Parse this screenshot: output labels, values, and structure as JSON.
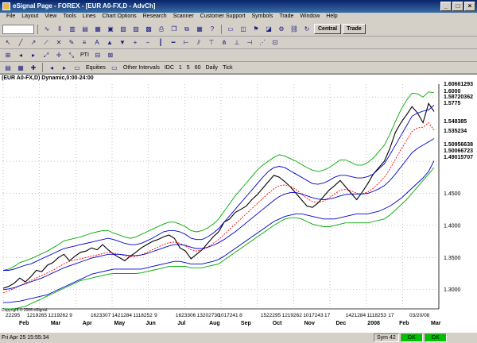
{
  "window": {
    "title": "eSignal Page - FOREX - [EUR A0-FX,D - AdvCh]"
  },
  "menu": [
    "File",
    "Layout",
    "View",
    "Tools",
    "Lines",
    "Chart Options",
    "Research",
    "Scanner",
    "Customer Support",
    "Symbols",
    "Trade",
    "Window",
    "Help"
  ],
  "toolbar": {
    "central_label": "Central",
    "trade_label": "Trade",
    "pti_label": "PTI"
  },
  "interval_bar": {
    "equities_label": "Equities",
    "other_intervals_label": "Other Intervals",
    "intervals": [
      "IDC",
      "1",
      "5",
      "60",
      "Daily",
      "Tick"
    ]
  },
  "chart": {
    "title": "(EUR A0-FX,D) Dynamic,0:00-24:00",
    "copyright": "Copyright © 2006 eSignal."
  },
  "chart_data": {
    "type": "line",
    "price_axis_labels": [
      "1.4000",
      "1.4500",
      "1.3500",
      "1.3000"
    ],
    "value_tags": [
      {
        "value": "1.60661293",
        "bg": "#ffffff"
      },
      {
        "value": "1.6000",
        "bg": "#ffffff"
      },
      {
        "value": "1.58720362",
        "bg": "#ffffff"
      },
      {
        "value": "1.5775",
        "bg": "#ffffff"
      },
      {
        "value": "1.548385",
        "bg": "#ffffff"
      },
      {
        "value": "1.535234",
        "bg": "#ffffff"
      },
      {
        "value": "1.50956638",
        "bg": "#ffffff"
      },
      {
        "value": "1.50066723",
        "bg": "#ffffff"
      },
      {
        "value": "1.49015707",
        "bg": "#ffffff"
      }
    ],
    "date_number_row": [
      "22295",
      "1219265",
      "1219262",
      "9",
      "1623307",
      "1421284",
      "1118252",
      "9",
      "1623306",
      "13202730",
      "1017241",
      "8",
      "1522295",
      "1219262",
      "1017243",
      "17",
      "1421284",
      "1118253",
      "17",
      "03/20/08"
    ],
    "month_labels": [
      "Feb",
      "Mar",
      "Apr",
      "May",
      "Jun",
      "Jul",
      "Aug",
      "Sep",
      "Oct",
      "Nov",
      "Dec",
      "2008",
      "Feb",
      "Mar"
    ],
    "series": [
      {
        "color": "#000000",
        "values": [
          1.302,
          1.305,
          1.31,
          1.318,
          1.312,
          1.32,
          1.33,
          1.328,
          1.338,
          1.342,
          1.35,
          1.355,
          1.345,
          1.352,
          1.358,
          1.36,
          1.365,
          1.362,
          1.37,
          1.362,
          1.355,
          1.35,
          1.345,
          1.352,
          1.358,
          1.365,
          1.37,
          1.375,
          1.378,
          1.382,
          1.385,
          1.38,
          1.365,
          1.36,
          1.348,
          1.355,
          1.362,
          1.372,
          1.382,
          1.39,
          1.405,
          1.41,
          1.42,
          1.425,
          1.43,
          1.44,
          1.448,
          1.458,
          1.468,
          1.478,
          1.475,
          1.468,
          1.46,
          1.45,
          1.44,
          1.43,
          1.428,
          1.435,
          1.445,
          1.455,
          1.462,
          1.47,
          1.46,
          1.45,
          1.44,
          1.452,
          1.465,
          1.48,
          1.49,
          1.5,
          1.52,
          1.545,
          1.56,
          1.572,
          1.585,
          1.575,
          1.56,
          1.59,
          1.5775
        ]
      },
      {
        "color": "#ff0000",
        "values": [
          1.295,
          1.298,
          1.302,
          1.306,
          1.31,
          1.314,
          1.318,
          1.322,
          1.326,
          1.33,
          1.335,
          1.34,
          1.344,
          1.346,
          1.348,
          1.35,
          1.352,
          1.354,
          1.356,
          1.358,
          1.357,
          1.355,
          1.353,
          1.351,
          1.352,
          1.354,
          1.358,
          1.362,
          1.366,
          1.37,
          1.373,
          1.374,
          1.372,
          1.368,
          1.362,
          1.36,
          1.362,
          1.366,
          1.372,
          1.378,
          1.386,
          1.394,
          1.402,
          1.41,
          1.418,
          1.426,
          1.434,
          1.442,
          1.45,
          1.457,
          1.462,
          1.463,
          1.461,
          1.456,
          1.449,
          1.442,
          1.437,
          1.436,
          1.438,
          1.443,
          1.449,
          1.455,
          1.456,
          1.454,
          1.45,
          1.449,
          1.452,
          1.458,
          1.466,
          1.475,
          1.488,
          1.503,
          1.518,
          1.532,
          1.546,
          1.552,
          1.553,
          1.56,
          1.548385
        ]
      },
      {
        "color": "#0000cc",
        "values": [
          1.3,
          1.301,
          1.303,
          1.306,
          1.309,
          1.312,
          1.315,
          1.318,
          1.322,
          1.326,
          1.33,
          1.334,
          1.337,
          1.34,
          1.343,
          1.346,
          1.349,
          1.351,
          1.353,
          1.355,
          1.355,
          1.355,
          1.354,
          1.353,
          1.353,
          1.354,
          1.356,
          1.359,
          1.362,
          1.365,
          1.368,
          1.37,
          1.37,
          1.369,
          1.366,
          1.364,
          1.364,
          1.366,
          1.369,
          1.373,
          1.378,
          1.384,
          1.39,
          1.397,
          1.404,
          1.411,
          1.418,
          1.425,
          1.432,
          1.439,
          1.445,
          1.449,
          1.451,
          1.451,
          1.449,
          1.446,
          1.443,
          1.441,
          1.44,
          1.441,
          1.443,
          1.446,
          1.448,
          1.449,
          1.449,
          1.449,
          1.45,
          1.453,
          1.457,
          1.462,
          1.47,
          1.48,
          1.491,
          1.502,
          1.513,
          1.52,
          1.525,
          1.53,
          1.535234
        ]
      },
      {
        "color": "#00aa00",
        "values": [
          1.33,
          1.332,
          1.336,
          1.342,
          1.345,
          1.348,
          1.352,
          1.356,
          1.36,
          1.365,
          1.37,
          1.376,
          1.378,
          1.38,
          1.382,
          1.385,
          1.388,
          1.39,
          1.392,
          1.392,
          1.388,
          1.385,
          1.382,
          1.38,
          1.382,
          1.386,
          1.39,
          1.394,
          1.398,
          1.402,
          1.405,
          1.405,
          1.402,
          1.398,
          1.392,
          1.39,
          1.392,
          1.396,
          1.402,
          1.41,
          1.422,
          1.434,
          1.446,
          1.456,
          1.466,
          1.476,
          1.486,
          1.494,
          1.5,
          1.506,
          1.51,
          1.508,
          1.504,
          1.5,
          1.495,
          1.49,
          1.486,
          1.484,
          1.486,
          1.49,
          1.496,
          1.502,
          1.502,
          1.498,
          1.494,
          1.494,
          1.498,
          1.505,
          1.515,
          1.525,
          1.542,
          1.562,
          1.58,
          1.595,
          1.606,
          1.605,
          1.6,
          1.608,
          1.60661293
        ]
      },
      {
        "color": "#00aa00",
        "values": [
          1.27,
          1.27,
          1.27,
          1.272,
          1.274,
          1.278,
          1.282,
          1.286,
          1.29,
          1.294,
          1.298,
          1.302,
          1.306,
          1.31,
          1.314,
          1.316,
          1.318,
          1.32,
          1.322,
          1.324,
          1.325,
          1.325,
          1.325,
          1.325,
          1.325,
          1.326,
          1.328,
          1.33,
          1.332,
          1.334,
          1.336,
          1.336,
          1.336,
          1.336,
          1.334,
          1.334,
          1.334,
          1.336,
          1.338,
          1.34,
          1.346,
          1.352,
          1.358,
          1.364,
          1.37,
          1.376,
          1.382,
          1.388,
          1.394,
          1.4,
          1.405,
          1.41,
          1.412,
          1.412,
          1.41,
          1.406,
          1.402,
          1.4,
          1.398,
          1.398,
          1.4,
          1.402,
          1.404,
          1.404,
          1.404,
          1.404,
          1.404,
          1.406,
          1.408,
          1.41,
          1.416,
          1.424,
          1.432,
          1.44,
          1.45,
          1.46,
          1.47,
          1.48,
          1.49015707
        ]
      },
      {
        "color": "#0000cc",
        "values": [
          1.33,
          1.33,
          1.332,
          1.335,
          1.338,
          1.34,
          1.344,
          1.348,
          1.352,
          1.356,
          1.36,
          1.364,
          1.366,
          1.368,
          1.37,
          1.372,
          1.374,
          1.376,
          1.378,
          1.38,
          1.378,
          1.375,
          1.372,
          1.37,
          1.37,
          1.372,
          1.376,
          1.38,
          1.385,
          1.39,
          1.392,
          1.392,
          1.39,
          1.386,
          1.38,
          1.378,
          1.378,
          1.382,
          1.388,
          1.395,
          1.405,
          1.415,
          1.425,
          1.435,
          1.445,
          1.455,
          1.465,
          1.475,
          1.484,
          1.49,
          1.492,
          1.49,
          1.485,
          1.48,
          1.475,
          1.47,
          1.465,
          1.464,
          1.466,
          1.47,
          1.475,
          1.478,
          1.478,
          1.476,
          1.474,
          1.474,
          1.476,
          1.48,
          1.488,
          1.496,
          1.51,
          1.525,
          1.54,
          1.555,
          1.57,
          1.575,
          1.578,
          1.58,
          1.58720362
        ]
      },
      {
        "color": "#0000cc",
        "values": [
          1.28,
          1.28,
          1.281,
          1.282,
          1.284,
          1.286,
          1.288,
          1.29,
          1.292,
          1.296,
          1.3,
          1.304,
          1.308,
          1.312,
          1.316,
          1.32,
          1.324,
          1.326,
          1.328,
          1.33,
          1.332,
          1.332,
          1.332,
          1.332,
          1.332,
          1.332,
          1.334,
          1.336,
          1.338,
          1.34,
          1.342,
          1.344,
          1.344,
          1.342,
          1.34,
          1.34,
          1.34,
          1.342,
          1.344,
          1.347,
          1.352,
          1.358,
          1.364,
          1.37,
          1.376,
          1.382,
          1.388,
          1.394,
          1.4,
          1.406,
          1.41,
          1.414,
          1.416,
          1.418,
          1.418,
          1.416,
          1.414,
          1.412,
          1.41,
          1.41,
          1.41,
          1.412,
          1.414,
          1.416,
          1.418,
          1.418,
          1.418,
          1.42,
          1.422,
          1.426,
          1.43,
          1.436,
          1.442,
          1.45,
          1.458,
          1.466,
          1.474,
          1.484,
          1.50066723
        ]
      }
    ]
  },
  "status": {
    "datetime": "Fri Apr 25 15:55:34",
    "sym": "Sym 42",
    "ok1": "OK",
    "ok2": "OK"
  }
}
